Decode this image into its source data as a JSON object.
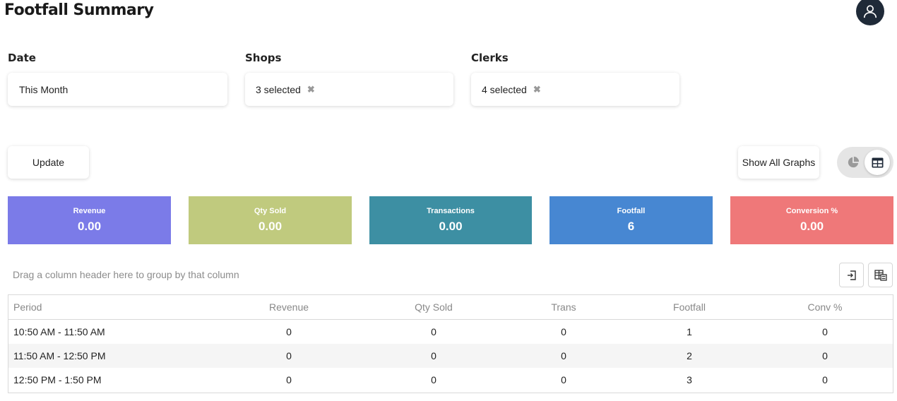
{
  "header": {
    "title": "Footfall Summary"
  },
  "filters": {
    "date": {
      "label": "Date",
      "value": "This Month"
    },
    "shops": {
      "label": "Shops",
      "value": "3 selected"
    },
    "clerks": {
      "label": "Clerks",
      "value": "4 selected"
    }
  },
  "toolbar": {
    "update_label": "Update",
    "show_graphs_label": "Show All Graphs"
  },
  "kpis": [
    {
      "label": "Revenue",
      "value": "0.00",
      "color": "#7b7be8"
    },
    {
      "label": "Qty Sold",
      "value": "0.00",
      "color": "#c0ca7e"
    },
    {
      "label": "Transactions",
      "value": "0.00",
      "color": "#3d8fa3"
    },
    {
      "label": "Footfall",
      "value": "6",
      "color": "#4787d2"
    },
    {
      "label": "Conversion %",
      "value": "0.00",
      "color": "#ef7879"
    }
  ],
  "grid": {
    "group_hint": "Drag a column header here to group by that column",
    "columns": [
      "Period",
      "Revenue",
      "Qty Sold",
      "Trans",
      "Footfall",
      "Conv %"
    ],
    "rows": [
      [
        "10:50 AM - 11:50 AM",
        "0",
        "0",
        "0",
        "1",
        "0"
      ],
      [
        "11:50 AM - 12:50 PM",
        "0",
        "0",
        "0",
        "2",
        "0"
      ],
      [
        "12:50 PM - 1:50 PM",
        "0",
        "0",
        "0",
        "3",
        "0"
      ]
    ]
  }
}
